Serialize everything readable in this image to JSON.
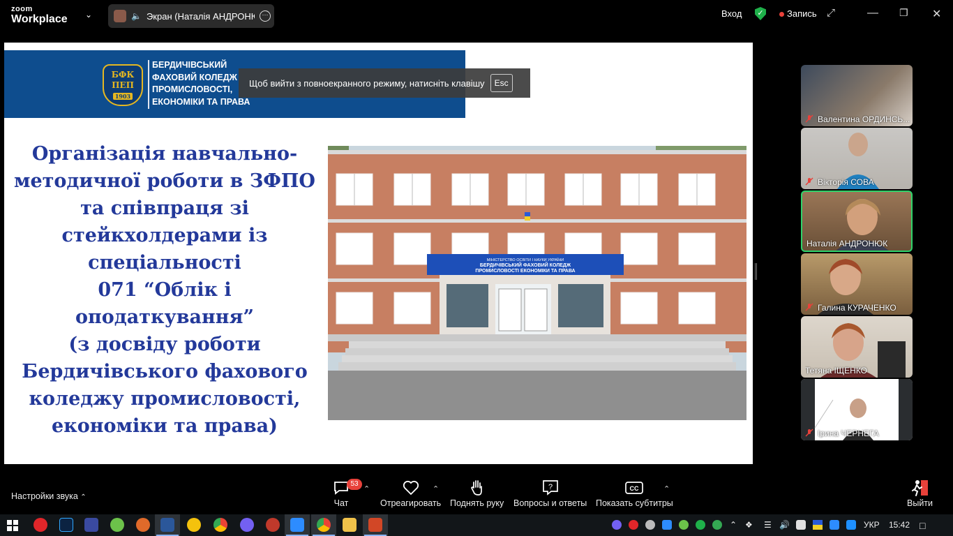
{
  "app": {
    "brand_small": "zoom",
    "brand_large": "Workplace"
  },
  "share_indicator": {
    "text": "Экран (Наталія АНДРОНЮК"
  },
  "top_right": {
    "signin": "Вход",
    "record": "Запись"
  },
  "slide": {
    "college_name_lines": [
      "БЕРДИЧІВСЬКИЙ",
      "ФАХОВИЙ КОЛЕДЖ",
      "ПРОМИСЛОВОСТІ,",
      "ЕКОНОМІКИ ТА ПРАВА"
    ],
    "logo_text": [
      "БФК",
      "ПЕП"
    ],
    "logo_year": "1903",
    "title_lines": [
      "Організація навчально-",
      "методичної роботи в ЗФПО",
      "та співпраця зі",
      "стейкхолдерами із",
      "спеціальності",
      "071 “Облік і оподаткування”",
      "(з досвіду роботи",
      "Бердичівського фахового",
      "коледжу промисловості,",
      "економіки та права)"
    ],
    "building_sign_line1": "МІНІСТЕРСТВО ОСВІТИ І НАУКИ УКРАЇНИ",
    "building_sign_line2": "БЕРДИЧІВСЬКИЙ ФАХОВИЙ КОЛЕДЖ",
    "building_sign_line3": "ПРОМИСЛОВОСТІ ЕКОНОМІКИ ТА ПРАВА"
  },
  "fullscreen_tip": {
    "text": "Щоб вийти з повноекранного режиму, натисніть клавішу",
    "key": "Esc"
  },
  "participants": [
    {
      "name": "Валентина ОРДИНСЬ...",
      "muted": true
    },
    {
      "name": "Вікторія СОВА",
      "muted": true
    },
    {
      "name": "Наталія АНДРОНЮК",
      "muted": false,
      "active": true
    },
    {
      "name": "Галина КУРАЧЕНКО",
      "muted": true
    },
    {
      "name": "Тетяна ІЩЕНКО",
      "muted": false
    },
    {
      "name": "Ірина ЧЕРНЕГА",
      "muted": true
    }
  ],
  "toolbar": {
    "audio_settings": "Настройки звука",
    "chat": "Чат",
    "chat_badge": "53",
    "react": "Отреагировать",
    "raise_hand": "Поднять руку",
    "qa": "Вопросы и ответы",
    "captions": "Показать субтитры",
    "leave": "Выйти"
  },
  "taskbar": {
    "lang": "УКР",
    "time": "15:42"
  },
  "colors": {
    "accent_green": "#2fd36a",
    "record_red": "#e8413a",
    "banner_blue": "#0e4d8e",
    "title_blue": "#23399a"
  }
}
